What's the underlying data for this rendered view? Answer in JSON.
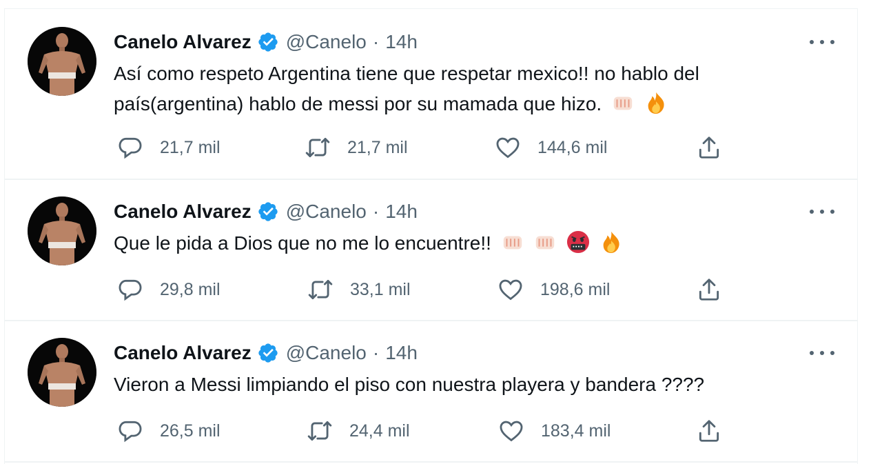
{
  "tweets": [
    {
      "name": "Canelo Alvarez",
      "handle": "@Canelo",
      "separator": "·",
      "time": "14h",
      "text": "Así como respeto Argentina tiene que respetar mexico!! no hablo del país(argentina) hablo de messi por su mamada que hizo.",
      "emojis": [
        "fist-emoji",
        "fire-emoji"
      ],
      "replies": "21,7 mil",
      "retweets": "21,7 mil",
      "likes": "144,6 mil"
    },
    {
      "name": "Canelo Alvarez",
      "handle": "@Canelo",
      "separator": "·",
      "time": "14h",
      "text": "Que le pida a Dios que no me lo encuentre!!",
      "emojis": [
        "fist-emoji",
        "fist-emoji",
        "cursing-face-emoji",
        "fire-emoji"
      ],
      "replies": "29,8 mil",
      "retweets": "33,1 mil",
      "likes": "198,6 mil"
    },
    {
      "name": "Canelo Alvarez",
      "handle": "@Canelo",
      "separator": "·",
      "time": "14h",
      "text": "Vieron a Messi limpiando el piso con nuestra playera y bandera ????",
      "emojis": [],
      "replies": "26,5 mil",
      "retweets": "24,4 mil",
      "likes": "183,4 mil"
    }
  ],
  "colors": {
    "verified": "#1d9bf0",
    "secondary_text": "#536471",
    "primary_text": "#0f1419",
    "divider": "#eff3f4"
  },
  "icons": [
    "reply-icon",
    "retweet-icon",
    "like-icon",
    "share-icon",
    "more-icon",
    "verified-badge-icon"
  ]
}
